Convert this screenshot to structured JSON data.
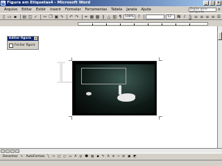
{
  "window": {
    "title": "Figura em Etiquetas4 - Microsoft Word"
  },
  "menu": [
    "Arquivo",
    "Editar",
    "Exibir",
    "Inserir",
    "Formatar",
    "Ferramentas",
    "Tabela",
    "Janela",
    "Ajuda"
  ],
  "help_placeholder": "Digite uma pergunta",
  "toolbar": {
    "zoom": "100%",
    "font_size": "12"
  },
  "floating_toolbar": {
    "title": "Editar figura",
    "button": "Fechar figura"
  },
  "watermark_text": "Lc",
  "drawing_toolbar": {
    "draw": "Desenhar",
    "autoshapes": "AutoFormas"
  }
}
